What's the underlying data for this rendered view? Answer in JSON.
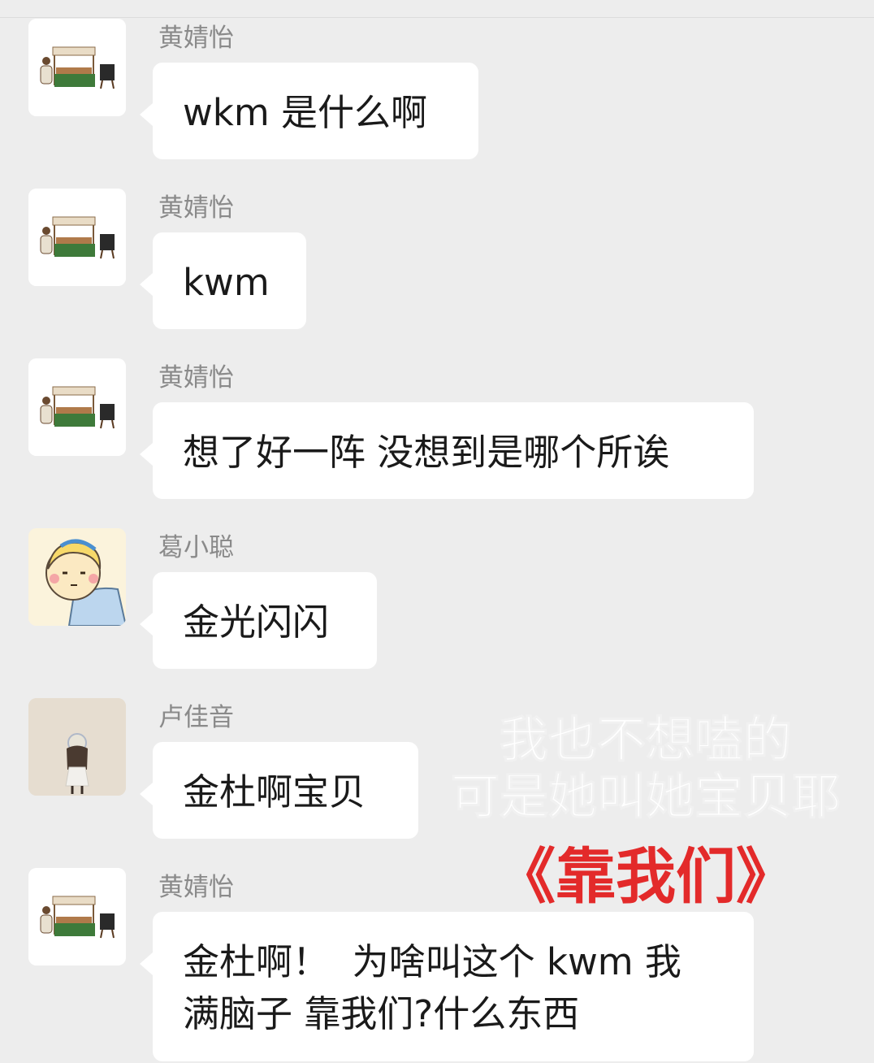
{
  "messages": [
    {
      "sender": "黄婧怡",
      "text": "wkm 是什么啊",
      "avatar": "market-stall-avatar"
    },
    {
      "sender": "黄婧怡",
      "text": "kwm",
      "avatar": "market-stall-avatar"
    },
    {
      "sender": "黄婧怡",
      "text": "想了好一阵 没想到是哪个所诶",
      "avatar": "market-stall-avatar"
    },
    {
      "sender": "葛小聪",
      "text": "金光闪闪",
      "avatar": "cartoon-girl-avatar"
    },
    {
      "sender": "卢佳音",
      "text": "金杜啊宝贝",
      "avatar": "photo-person-avatar"
    },
    {
      "sender": "黄婧怡",
      "text": "金杜啊！  为啥叫这个 kwm 我\n满脑子 靠我们?什么东西",
      "avatar": "market-stall-avatar"
    }
  ],
  "overlay": {
    "line1": "我也不想嗑的",
    "line2": "可是她叫她宝贝耶",
    "line3": "《靠我们》",
    "line3_color": "#e32a2a"
  },
  "colors": {
    "background": "#ededed",
    "bubble": "#ffffff",
    "sender_name": "#8a8a8a"
  }
}
